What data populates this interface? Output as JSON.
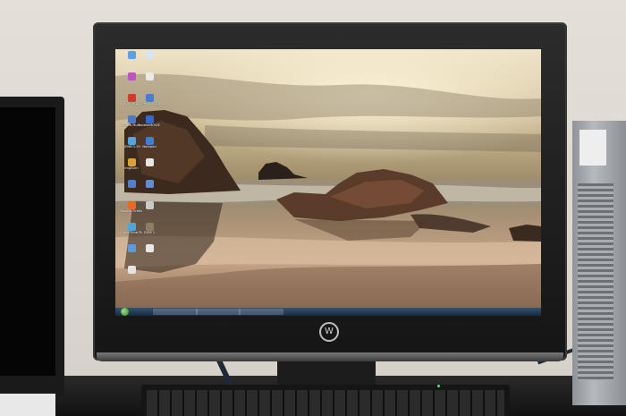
{
  "monitor": {
    "brand_logo": "W"
  },
  "desktop": {
    "icons": [
      {
        "label": "",
        "color": "#5aa0e8"
      },
      {
        "label": "",
        "color": "#d6e4f5"
      },
      {
        "label": "",
        "color": "#c24fd0"
      },
      {
        "label": "",
        "color": "#e9e9e9"
      },
      {
        "label": "AVG 2012",
        "color": "#d23a2c"
      },
      {
        "label": "GOM ENCODER",
        "color": "#3f7fd6"
      },
      {
        "label": "EPSON Multi-Print",
        "color": "#4b7ac2"
      },
      {
        "label": "mobileMOVIE 4.1",
        "color": "#2f6bcf"
      },
      {
        "label": "GENIE3-19",
        "color": "#4fa6e0"
      },
      {
        "label": "Notepad",
        "color": "#3d7ed6"
      },
      {
        "label": "ImgBurn",
        "color": "#e0a030"
      },
      {
        "label": "",
        "color": "#e6e6e6"
      },
      {
        "label": "",
        "color": "#4d7fd0"
      },
      {
        "label": "",
        "color": "#5d8ed6"
      },
      {
        "label": "Mozilla Firefox",
        "color": "#e86a1e"
      },
      {
        "label": "",
        "color": "#c9c9c9"
      },
      {
        "label": "QuickTime Player",
        "color": "#4aa8e0"
      },
      {
        "label": "GIMP 2",
        "color": "#8f7f62"
      },
      {
        "label": "",
        "color": "#5b9ae6"
      },
      {
        "label": "",
        "color": "#e8e8e8"
      },
      {
        "label": "",
        "color": "#e3e3e3"
      }
    ]
  },
  "taskbar": {
    "buttons": [
      "",
      "",
      ""
    ],
    "tray_text": ""
  },
  "colors": {
    "sky_top": "#e9dfc6",
    "sky_bottom": "#b7a17a",
    "sea": "#8b7a5e",
    "sand": "#c9a98a",
    "rock": "#4a3426"
  }
}
